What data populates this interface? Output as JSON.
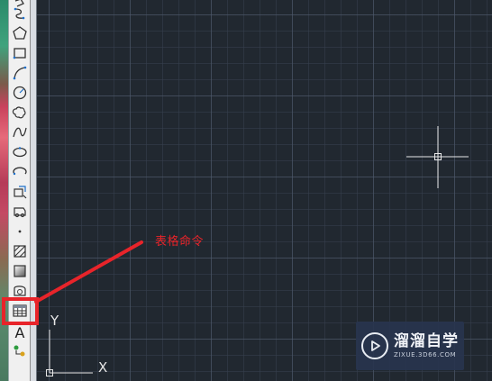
{
  "annotation": {
    "text": "表格命令",
    "color": "#e8242a"
  },
  "ucs": {
    "y_label": "Y",
    "x_label": "X"
  },
  "watermark": {
    "title": "溜溜自学",
    "subtitle": "ZIXUE.3D66.COM"
  },
  "toolbar": {
    "icons": [
      "polyline-icon",
      "polygon-icon",
      "rectangle-icon",
      "arc-icon",
      "circle-icon",
      "revision-cloud-icon",
      "spline-icon",
      "ellipse-icon",
      "ellipse-arc-icon",
      "insert-block-icon",
      "make-block-icon",
      "point-icon",
      "hatch-icon",
      "gradient-icon",
      "region-icon",
      "table-icon",
      "multiline-text-icon",
      "add-selected-icon"
    ],
    "selected": "table-icon"
  },
  "colors": {
    "canvas": "#212830",
    "toolbar": "#f0f0f0",
    "highlight": "#e8242a"
  }
}
